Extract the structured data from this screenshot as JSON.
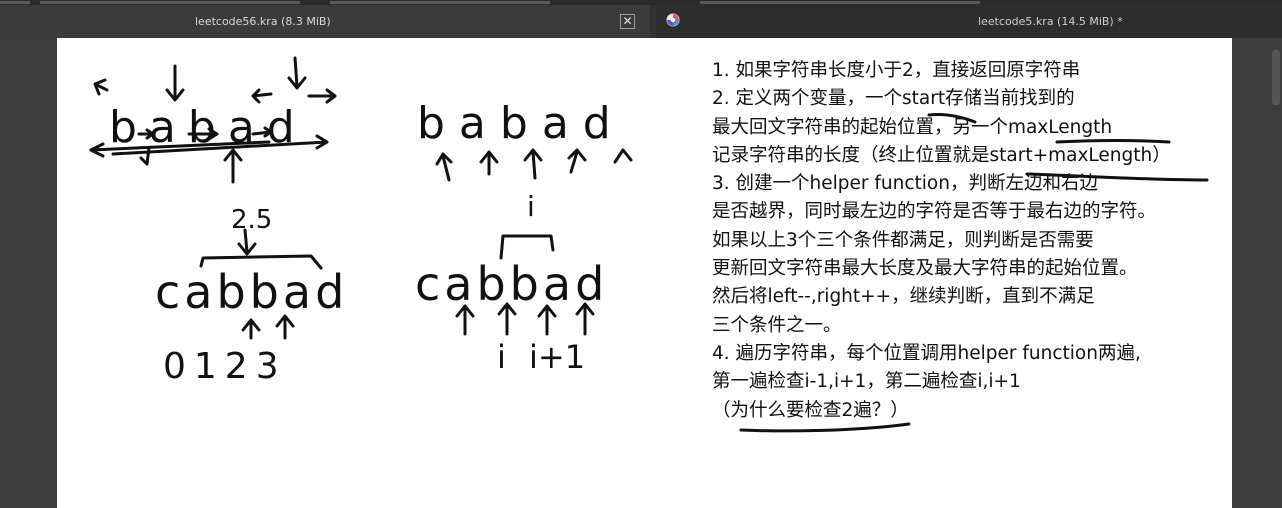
{
  "tabs": [
    {
      "title": "leetcode56.kra (8.3 MiB)",
      "close_glyph": "✕"
    },
    {
      "title": "leetcode5.kra (14.5 MiB) *"
    }
  ],
  "colors": {
    "canvas": "#ffffff",
    "ink": "#111111",
    "chrome": "#3a3a3a"
  },
  "notes": [
    "1. 如果字符串长度小于2，直接返回原字符串",
    "2. 定义两个变量，一个start存储当前找到的",
    "最大回文字符串的起始位置，另一个maxLength",
    "记录字符串的长度（终止位置就是start+maxLength）",
    "3. 创建一个helper function，判断左边和右边",
    "是否越界，同时最左边的字符是否等于最右边的字符。",
    " 如果以上3个三个条件都满足，则判断是否需要",
    "更新回文字符串最大长度及最大字符串的起始位置。",
    "然后将left--,right++，继续判断，直到不满足",
    "三个条件之一。",
    "4. 遍历字符串，每个位置调用helper function两遍,",
    "第一遍检查i-1,i+1，第二遍检查i,i+1",
    "（为什么要检查2遍？）"
  ],
  "handwriting": {
    "word_top_left": "babad",
    "word_top_right": "babad",
    "word_bottom_left": "cabbad",
    "word_bottom_right": "cabbad",
    "label_center": "2.5",
    "label_i": "i",
    "indices": "0123",
    "labels_i_i1": [
      "i",
      "i+1"
    ]
  }
}
